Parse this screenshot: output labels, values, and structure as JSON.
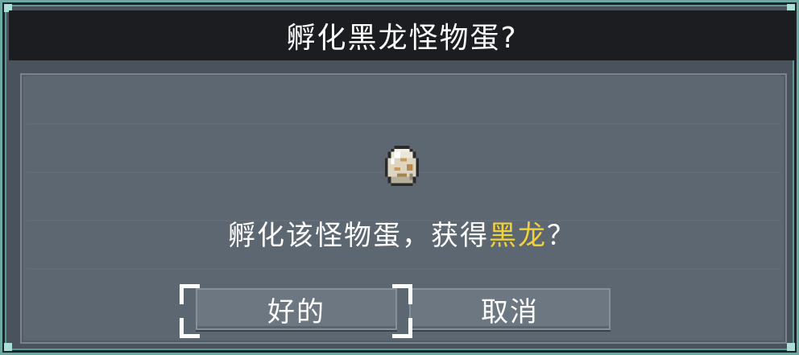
{
  "dialog": {
    "title": "孵化黑龙怪物蛋?",
    "message_prefix": "孵化该怪物蛋，获得",
    "message_highlight": "黑龙",
    "message_suffix": "？",
    "highlight_color": "#f2d23a",
    "item_icon": "monster-egg-icon"
  },
  "buttons": {
    "confirm_label": "好的",
    "cancel_label": "取消"
  }
}
